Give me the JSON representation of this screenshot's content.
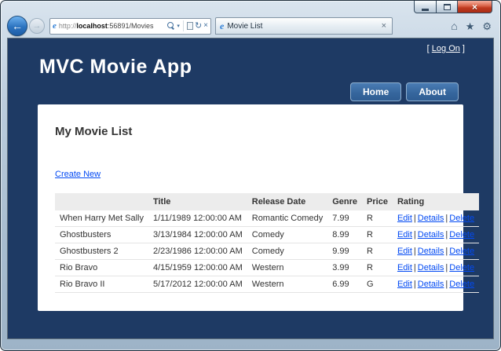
{
  "icons": {
    "back": "←",
    "forward": "→",
    "close": "×",
    "dropdown": "▾",
    "refresh": "↻",
    "stop": "×",
    "home": "⌂",
    "star": "★",
    "gear": "⚙",
    "ie": "e"
  },
  "browser": {
    "address": {
      "protocol": "http://",
      "host": "localhost",
      "path": ":56891/Movies"
    },
    "tab_title": "Movie List"
  },
  "page": {
    "logon": {
      "prefix": "[ ",
      "label": "Log On",
      "suffix": " ]"
    },
    "title": "MVC Movie App",
    "nav": [
      {
        "label": "Home"
      },
      {
        "label": "About"
      }
    ],
    "heading": "My Movie List",
    "create_link": "Create New",
    "table": {
      "headers": [
        "",
        "Title",
        "Release Date",
        "Genre",
        "Price",
        "Rating"
      ],
      "separator": "|",
      "actions": [
        "Edit",
        "Details",
        "Delete"
      ],
      "rows": [
        {
          "name": "When Harry Met Sally",
          "date": "1/11/1989 12:00:00 AM",
          "genre": "Romantic Comedy",
          "price": "7.99",
          "rating": "R"
        },
        {
          "name": "Ghostbusters",
          "date": "3/13/1984 12:00:00 AM",
          "genre": "Comedy",
          "price": "8.99",
          "rating": "R"
        },
        {
          "name": "Ghostbusters 2",
          "date": "2/23/1986 12:00:00 AM",
          "genre": "Comedy",
          "price": "9.99",
          "rating": "R"
        },
        {
          "name": "Rio Bravo",
          "date": "4/15/1959 12:00:00 AM",
          "genre": "Western",
          "price": "3.99",
          "rating": "R"
        },
        {
          "name": "Rio Bravo II",
          "date": "5/17/2012 12:00:00 AM",
          "genre": "Western",
          "price": "6.99",
          "rating": "G"
        }
      ]
    }
  }
}
